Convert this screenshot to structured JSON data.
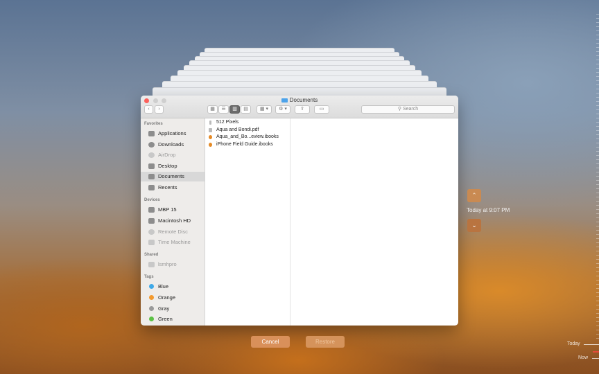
{
  "window": {
    "title": "Documents"
  },
  "toolbar": {
    "nav_back": "‹",
    "nav_forward": "›",
    "view_icons": "▦",
    "view_list": "☰",
    "view_columns": "▥",
    "view_gallery": "▤",
    "arrange": "▦ ▾",
    "action": "⚙ ▾",
    "share": "⇪",
    "tags": "▭",
    "search_placeholder": "Search"
  },
  "sidebar": {
    "favorites_header": "Favorites",
    "favorites": [
      {
        "label": "Applications",
        "icon": "applications-icon"
      },
      {
        "label": "Downloads",
        "icon": "downloads-icon"
      },
      {
        "label": "AirDrop",
        "icon": "airdrop-icon",
        "dim": true
      },
      {
        "label": "Desktop",
        "icon": "desktop-icon"
      },
      {
        "label": "Documents",
        "icon": "documents-icon",
        "selected": true
      },
      {
        "label": "Recents",
        "icon": "recents-icon"
      }
    ],
    "devices_header": "Devices",
    "devices": [
      {
        "label": "MBP 15",
        "icon": "laptop-icon"
      },
      {
        "label": "Macintosh HD",
        "icon": "hard-drive-icon"
      },
      {
        "label": "Remote Disc",
        "icon": "disc-icon",
        "dim": true
      },
      {
        "label": "Time Machine",
        "icon": "time-machine-icon",
        "dim": true
      }
    ],
    "shared_header": "Shared",
    "shared": [
      {
        "label": "lsmhpro",
        "icon": "network-computer-icon",
        "dim": true
      }
    ],
    "tags_header": "Tags",
    "tags": [
      {
        "label": "Blue",
        "color": "#3fa9e8"
      },
      {
        "label": "Orange",
        "color": "#f39a2e"
      },
      {
        "label": "Gray",
        "color": "#9a9a9a"
      },
      {
        "label": "Green",
        "color": "#5cc245"
      }
    ]
  },
  "files": [
    {
      "name": "512 Pixels",
      "icon": "alias-icon"
    },
    {
      "name": "Aqua and Bondi.pdf",
      "icon": "pdf-icon"
    },
    {
      "name": "Aqua_and_Bo...eview.ibooks",
      "icon": "ibooks-icon"
    },
    {
      "name": "iPhone Field Guide.ibooks",
      "icon": "ibooks-icon"
    }
  ],
  "time_machine": {
    "up_arrow": "⌃",
    "down_arrow": "⌄",
    "date_label": "Today at 9:07 PM",
    "cancel_label": "Cancel",
    "restore_label": "Restore",
    "timeline_today": "Today",
    "timeline_now": "Now"
  },
  "colors": {
    "accent_button": "#d9905a",
    "selection": "#d8d8d8",
    "close": "#fc605c"
  }
}
